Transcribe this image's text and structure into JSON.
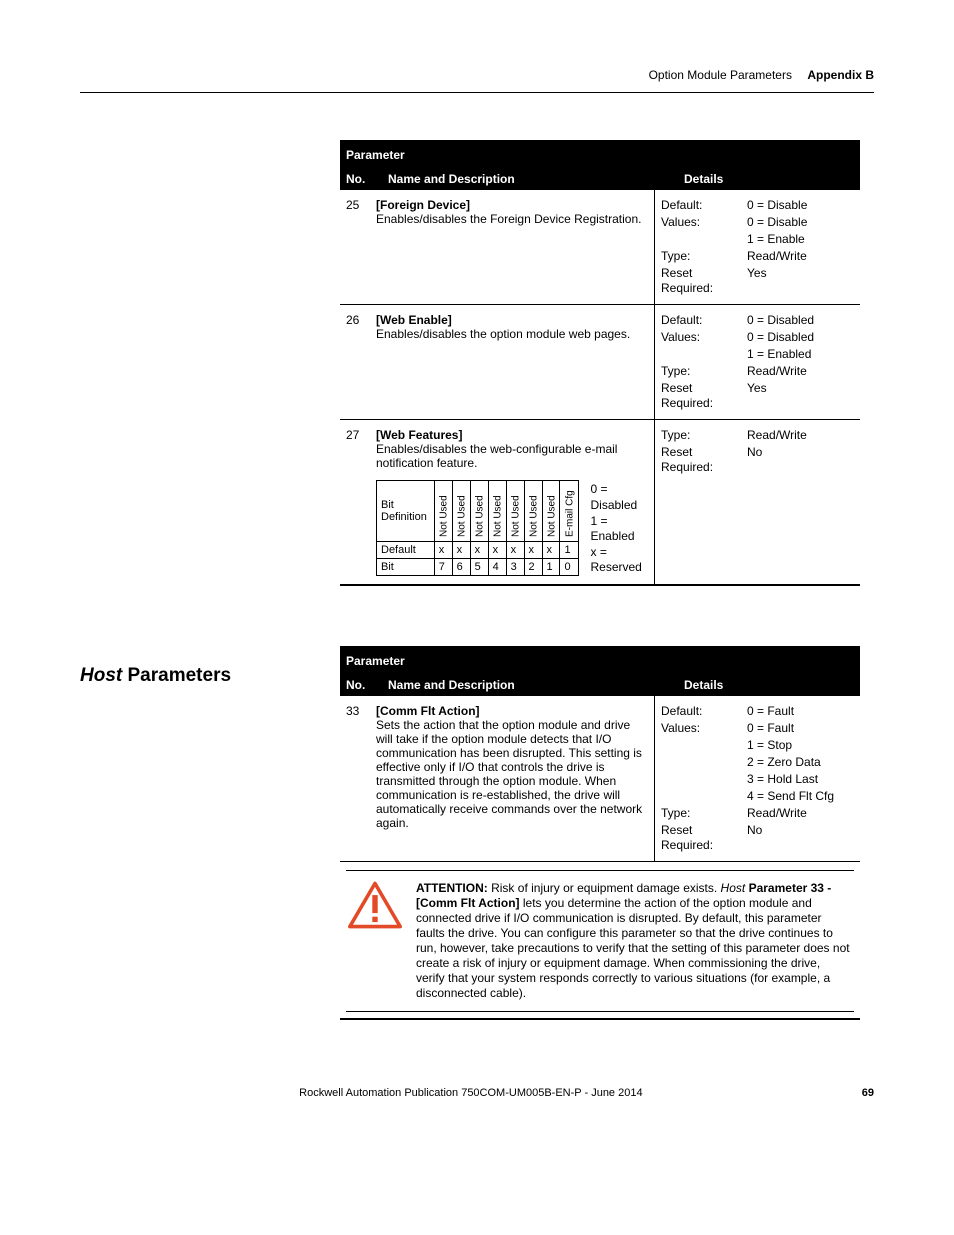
{
  "header": {
    "breadcrumb": "Option Module Parameters",
    "appendix": "Appendix B"
  },
  "tables": {
    "t1": {
      "title": "Parameter",
      "cols": {
        "no": "No.",
        "name": "Name and Description",
        "details": "Details"
      },
      "rows": [
        {
          "no": "25",
          "name": "[Foreign Device]",
          "desc": "Enables/disables the Foreign Device Registration.",
          "details": {
            "default_l": "Default:",
            "default_v": "0 = Disable",
            "values_l": "Values:",
            "values_v1": "0 = Disable",
            "values_v2": "1 = Enable",
            "type_l": "Type:",
            "type_v": "Read/Write",
            "reset_l": "Reset Required:",
            "reset_v": "Yes"
          }
        },
        {
          "no": "26",
          "name": "[Web Enable]",
          "desc": "Enables/disables the option module web pages.",
          "details": {
            "default_l": "Default:",
            "default_v": "0 = Disabled",
            "values_l": "Values:",
            "values_v1": "0 = Disabled",
            "values_v2": "1 = Enabled",
            "type_l": "Type:",
            "type_v": "Read/Write",
            "reset_l": "Reset Required:",
            "reset_v": "Yes"
          }
        },
        {
          "no": "27",
          "name": "[Web Features]",
          "desc": "Enables/disables the web-configurable e-mail notification feature.",
          "details": {
            "type_l": "Type:",
            "type_v": "Read/Write",
            "reset_l": "Reset Required:",
            "reset_v": "No"
          },
          "bit": {
            "head0": "Bit Definition",
            "cols": [
              "Not Used",
              "Not Used",
              "Not Used",
              "Not Used",
              "Not Used",
              "Not Used",
              "Not Used",
              "E-mail Cfg"
            ],
            "row2l": "Default",
            "row2": [
              "x",
              "x",
              "x",
              "x",
              "x",
              "x",
              "x",
              "1"
            ],
            "row3l": "Bit",
            "row3": [
              "7",
              "6",
              "5",
              "4",
              "3",
              "2",
              "1",
              "0"
            ],
            "legend0": "0 = Disabled",
            "legend1": "1 = Enabled",
            "legendx": "x = Reserved"
          }
        }
      ]
    },
    "t2": {
      "sectionTitlePrefix": "Host",
      "sectionTitleRest": " Parameters",
      "title": "Parameter",
      "cols": {
        "no": "No.",
        "name": "Name and Description",
        "details": "Details"
      },
      "rows": [
        {
          "no": "33",
          "name": "[Comm Flt Action]",
          "desc": "Sets the action that the option module and drive will take if the option module detects that I/O communication has been disrupted. This setting is effective only if I/O that controls the drive is transmitted through the option module. When communication is re-established, the drive will automatically receive commands over the network again.",
          "details": {
            "default_l": "Default:",
            "default_v": "0 = Fault",
            "values_l": "Values:",
            "values_v1": "0 = Fault",
            "values_v2": "1 = Stop",
            "values_v3": "2 = Zero Data",
            "values_v4": "3 = Hold Last",
            "values_v5": "4 = Send Flt Cfg",
            "type_l": "Type:",
            "type_v": "Read/Write",
            "reset_l": "Reset Required:",
            "reset_v": "No"
          }
        }
      ],
      "attention": {
        "label": "ATTENTION:",
        "lead": " Risk of injury or equipment damage exists. ",
        "italic1": "Host",
        "bold1": "Parameter 33 - [Comm Flt Action]",
        "body": " lets you determine the action of the option module and connected drive if I/O communication is disrupted. By default, this parameter faults the drive. You can configure this parameter so that the drive continues to run, however, take precautions to verify that the setting of this parameter does not create a risk of injury or equipment damage. When commissioning the drive, verify that your system responds correctly to various situations (for example, a disconnected cable)."
      }
    }
  },
  "footer": {
    "pub": "Rockwell Automation Publication 750COM-UM005B-EN-P - June 2014",
    "page": "69"
  }
}
